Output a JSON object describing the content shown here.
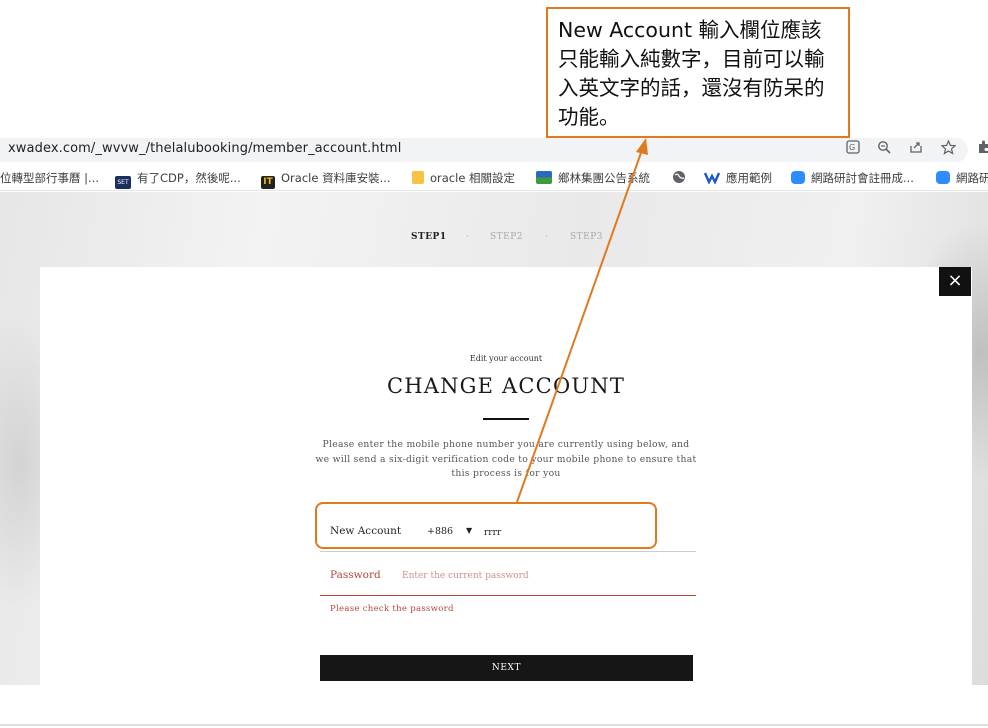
{
  "browser": {
    "url": "xwadex.com/_wvvw_/thelalubooking/member_account.html",
    "url_icons": [
      "translate-icon",
      "zoom-icon",
      "share-icon",
      "star-icon",
      "extension-icon"
    ],
    "bookmarks": [
      {
        "label": "位轉型部行事曆 |...",
        "icon": "none"
      },
      {
        "label": "有了CDP，然後呢...",
        "icon": "set-icon",
        "icon_text": "SET"
      },
      {
        "label": "Oracle 資料庫安裝...",
        "icon": "it-icon",
        "icon_text": "IT"
      },
      {
        "label": "oracle 相關設定",
        "icon": "folder-icon"
      },
      {
        "label": "鄉林集團公告系統",
        "icon": "flag-icon"
      },
      {
        "label": "",
        "icon": "globe-icon"
      },
      {
        "label": "應用範例",
        "icon": "v-icon"
      },
      {
        "label": "網路研討會註冊成...",
        "icon": "zoom-meeting-icon"
      },
      {
        "label": "網路研",
        "icon": "zoom-meeting-icon"
      }
    ]
  },
  "steps": [
    {
      "label": "STEP1",
      "active": true
    },
    {
      "label": "·",
      "active": false
    },
    {
      "label": "STEP2",
      "active": false
    },
    {
      "label": "·",
      "active": false
    },
    {
      "label": "STEP3",
      "active": false
    }
  ],
  "modal": {
    "close_symbol": "×",
    "eyebrow": "Edit your account",
    "title": "CHANGE ACCOUNT",
    "description": "Please enter the mobile phone number you are currently using below, and we will send a six-digit verification code to your mobile phone to ensure that this process is for you",
    "account_label": "New Account",
    "country_code": "+886",
    "account_value": "rrrr",
    "password_label": "Password",
    "password_placeholder": "Enter the current password",
    "error_message": "Please check the password",
    "next_label": "NEXT"
  },
  "annotation": {
    "callout_text": "New Account 輸入欄位應該只能輸入純數字，目前可以輸入英文字的話，還沒有防呆的功能。",
    "color": "#e07a1f"
  }
}
